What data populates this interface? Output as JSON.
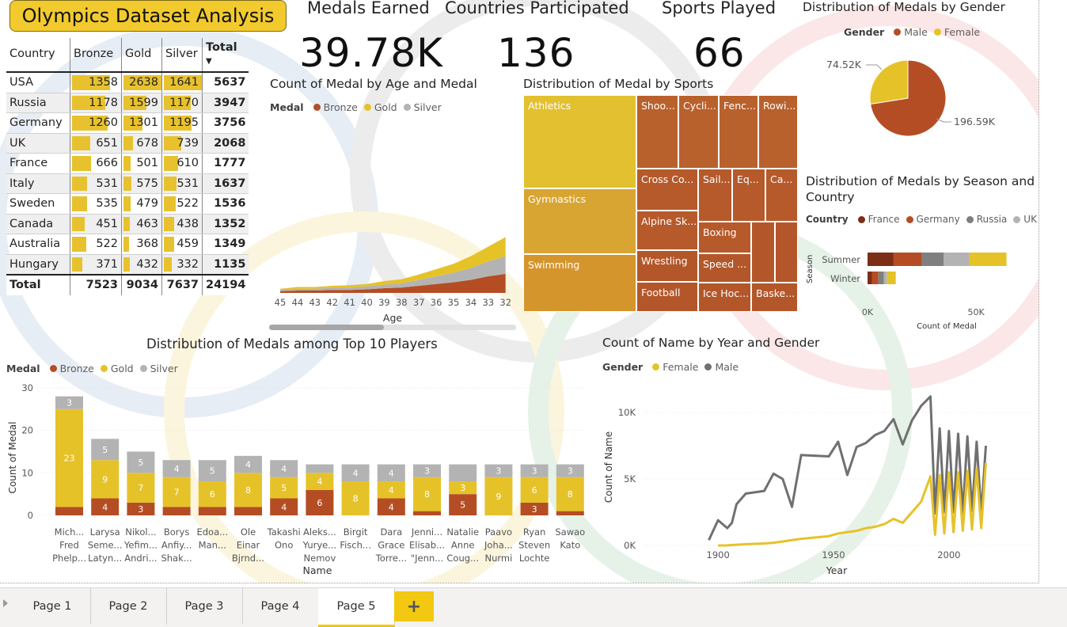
{
  "report_title": "Olympics Dataset Analysis",
  "kpis": [
    {
      "label": "Medals Earned",
      "value": "39.78K"
    },
    {
      "label": "Countries Participated",
      "value": "136"
    },
    {
      "label": "Sports Played",
      "value": "66"
    }
  ],
  "medal_table": {
    "headers": [
      "Country",
      "Bronze",
      "Gold",
      "Silver",
      "Total"
    ],
    "rows": [
      {
        "country": "USA",
        "bronze": 1358,
        "gold": 2638,
        "silver": 1641,
        "total": 5637
      },
      {
        "country": "Russia",
        "bronze": 1178,
        "gold": 1599,
        "silver": 1170,
        "total": 3947
      },
      {
        "country": "Germany",
        "bronze": 1260,
        "gold": 1301,
        "silver": 1195,
        "total": 3756
      },
      {
        "country": "UK",
        "bronze": 651,
        "gold": 678,
        "silver": 739,
        "total": 2068
      },
      {
        "country": "France",
        "bronze": 666,
        "gold": 501,
        "silver": 610,
        "total": 1777
      },
      {
        "country": "Italy",
        "bronze": 531,
        "gold": 575,
        "silver": 531,
        "total": 1637
      },
      {
        "country": "Sweden",
        "bronze": 535,
        "gold": 479,
        "silver": 522,
        "total": 1536
      },
      {
        "country": "Canada",
        "bronze": 451,
        "gold": 463,
        "silver": 438,
        "total": 1352
      },
      {
        "country": "Australia",
        "bronze": 522,
        "gold": 368,
        "silver": 459,
        "total": 1349
      },
      {
        "country": "Hungary",
        "bronze": 371,
        "gold": 432,
        "silver": 332,
        "total": 1135
      }
    ],
    "total_row": {
      "label": "Total",
      "bronze": 7523,
      "gold": 9034,
      "silver": 7637,
      "total": 24194
    }
  },
  "colors": {
    "bronze": "#b54d24",
    "gold": "#e6c229",
    "silver": "#b3b3b3",
    "male_gray": "#707070",
    "title_yellow": "#f2ca2e"
  },
  "chart_data": [
    {
      "id": "age_medal",
      "type": "area",
      "title": "Count of Medal by Age and Medal",
      "legend_title": "Medal",
      "legend": [
        "Bronze",
        "Gold",
        "Silver"
      ],
      "xlabel": "Age",
      "categories": [
        "45",
        "44",
        "43",
        "42",
        "41",
        "40",
        "39",
        "38",
        "37",
        "36",
        "35",
        "34",
        "33",
        "32"
      ],
      "series": [
        {
          "name": "Bronze",
          "values": [
            3,
            4,
            4,
            5,
            5,
            6,
            8,
            9,
            12,
            15,
            18,
            22,
            28,
            32
          ]
        },
        {
          "name": "Silver",
          "values": [
            2,
            3,
            3,
            4,
            4,
            5,
            6,
            7,
            10,
            13,
            16,
            20,
            25,
            30
          ]
        },
        {
          "name": "Gold",
          "values": [
            2,
            3,
            3,
            3,
            4,
            4,
            6,
            7,
            9,
            12,
            15,
            20,
            25,
            32
          ]
        }
      ]
    },
    {
      "id": "sports_treemap",
      "type": "treemap",
      "title": "Distribution of Medal by Sports",
      "items": [
        "Athletics",
        "Gymnastics",
        "Swimming",
        "Shoo...",
        "Cycli...",
        "Fenc...",
        "Rowi...",
        "Cross Co...",
        "Sail...",
        "Eq...",
        "Ca...",
        "Alpine Sk...",
        "Boxing",
        "Wrestling",
        "Speed ...",
        "Football",
        "Ice Hoc...",
        "Baske..."
      ]
    },
    {
      "id": "gender_pie",
      "type": "pie",
      "title": "Distribution of Medals by Gender",
      "legend_title": "Gender",
      "legend": [
        "Male",
        "Female"
      ],
      "categories": [
        "Male",
        "Female"
      ],
      "values": [
        196590,
        74520
      ],
      "labels": [
        "196.59K",
        "74.52K"
      ]
    },
    {
      "id": "season_country",
      "type": "bar",
      "orientation": "horizontal",
      "stacked": true,
      "title_lines": [
        "Distribution of Medals by Season and",
        "Country"
      ],
      "legend_title": "Country",
      "legend": [
        "France",
        "Germany",
        "Russia",
        "UK"
      ],
      "categories": [
        "Summer",
        "Winter"
      ],
      "ylabel": "Season",
      "xlabel": "Count of Medal",
      "xticks": [
        "0K",
        "50K"
      ],
      "xlim": [
        0,
        70000
      ],
      "series": [
        {
          "name": "France",
          "values": [
            12000,
            2000
          ]
        },
        {
          "name": "Germany",
          "values": [
            13000,
            3000
          ]
        },
        {
          "name": "Russia",
          "values": [
            10000,
            2500
          ]
        },
        {
          "name": "UK",
          "values": [
            12000,
            1500
          ]
        },
        {
          "name": "",
          "values": [
            17000,
            4000
          ]
        }
      ]
    },
    {
      "id": "top_players",
      "type": "bar",
      "stacked": true,
      "title": "Distribution of Medals among Top 10 Players",
      "legend_title": "Medal",
      "legend": [
        "Bronze",
        "Gold",
        "Silver"
      ],
      "xlabel": "Name",
      "ylabel": "Count of Medal",
      "yticks": [
        "0",
        "10",
        "20",
        "30"
      ],
      "ylim": [
        0,
        30
      ],
      "categories": [
        [
          "Mich...",
          "Fred",
          "Phelp..."
        ],
        [
          "Larysa",
          "Seme...",
          "Latyn..."
        ],
        [
          "Nikol...",
          "Yefim...",
          "Andri..."
        ],
        [
          "Borys",
          "Anfiy...",
          "Shak..."
        ],
        [
          "Edoa...",
          "Man..."
        ],
        [
          "Ole",
          "Einar",
          "Bjrnd..."
        ],
        [
          "Takashi",
          "Ono"
        ],
        [
          "Aleks...",
          "Yurye...",
          "Nemov"
        ],
        [
          "Birgit",
          "Fisch..."
        ],
        [
          "Dara",
          "Grace",
          "Torre..."
        ],
        [
          "Jenni...",
          "Elisab...",
          "\"Jenn..."
        ],
        [
          "Natalie",
          "Anne",
          "Coug..."
        ],
        [
          "Paavo",
          "Joha...",
          "Nurmi"
        ],
        [
          "Ryan",
          "Steven",
          "Lochte"
        ],
        [
          "Sawao",
          "Kato"
        ]
      ],
      "series": [
        {
          "name": "Bronze",
          "values": [
            2,
            4,
            3,
            2,
            2,
            2,
            4,
            6,
            0,
            4,
            1,
            5,
            0,
            3,
            1
          ]
        },
        {
          "name": "Gold",
          "values": [
            23,
            9,
            7,
            7,
            6,
            8,
            5,
            4,
            8,
            4,
            8,
            3,
            9,
            6,
            8
          ]
        },
        {
          "name": "Silver",
          "values": [
            3,
            5,
            5,
            4,
            5,
            4,
            4,
            2,
            4,
            4,
            3,
            4,
            3,
            3,
            3
          ]
        }
      ],
      "data_labels": {
        "Bronze": [
          "",
          "4",
          "3",
          "",
          "",
          "",
          "4",
          "6",
          "",
          "4",
          "",
          "5",
          "",
          "3",
          ""
        ],
        "Gold": [
          "23",
          "9",
          "7",
          "7",
          "6",
          "8",
          "5",
          "4",
          "8",
          "4",
          "8",
          "3",
          "9",
          "6",
          "8"
        ],
        "Silver": [
          "3",
          "5",
          "5",
          "4",
          "5",
          "4",
          "4",
          "",
          "4",
          "4",
          "3",
          "",
          "3",
          "3",
          "3"
        ]
      }
    },
    {
      "id": "year_gender",
      "type": "line",
      "title": "Count of Name by Year and Gender",
      "legend_title": "Gender",
      "legend": [
        "Female",
        "Male"
      ],
      "xlabel": "Year",
      "ylabel": "Count of Name",
      "xticks": [
        "1900",
        "1950",
        "2000"
      ],
      "yticks": [
        "0K",
        "5K",
        "10K"
      ],
      "xlim": [
        1890,
        2018
      ],
      "ylim": [
        0,
        11500
      ],
      "series": [
        {
          "name": "Male",
          "x": [
            1896,
            1900,
            1904,
            1906,
            1908,
            1912,
            1920,
            1924,
            1928,
            1932,
            1936,
            1948,
            1952,
            1956,
            1960,
            1964,
            1968,
            1972,
            1976,
            1980,
            1984,
            1988,
            1992,
            1994,
            1996,
            1998,
            2000,
            2002,
            2004,
            2006,
            2008,
            2010,
            2012,
            2014,
            2016
          ],
          "y": [
            400,
            1900,
            1300,
            1700,
            3100,
            3900,
            4100,
            5400,
            5000,
            2900,
            6800,
            6700,
            7800,
            5300,
            7400,
            7700,
            8300,
            8600,
            9500,
            7600,
            9400,
            10500,
            11200,
            2400,
            8800,
            2500,
            8600,
            2500,
            8400,
            2400,
            8200,
            2600,
            7800,
            2400,
            7500
          ]
        },
        {
          "name": "Female",
          "x": [
            1900,
            1904,
            1908,
            1912,
            1920,
            1924,
            1928,
            1932,
            1936,
            1948,
            1952,
            1956,
            1960,
            1964,
            1968,
            1972,
            1976,
            1980,
            1984,
            1988,
            1992,
            1994,
            1996,
            1998,
            2000,
            2002,
            2004,
            2006,
            2008,
            2010,
            2012,
            2014,
            2016
          ],
          "y": [
            0,
            10,
            50,
            100,
            150,
            200,
            300,
            400,
            500,
            700,
            900,
            1000,
            1100,
            1300,
            1400,
            1600,
            2000,
            1700,
            2500,
            3300,
            5200,
            800,
            5300,
            900,
            5500,
            1000,
            5500,
            1100,
            5600,
            1200,
            5800,
            1300,
            6200
          ]
        }
      ]
    }
  ],
  "tabs": [
    "Page 1",
    "Page 2",
    "Page 3",
    "Page 4",
    "Page 5"
  ],
  "active_tab": "Page 5",
  "add_tab_label": "+"
}
